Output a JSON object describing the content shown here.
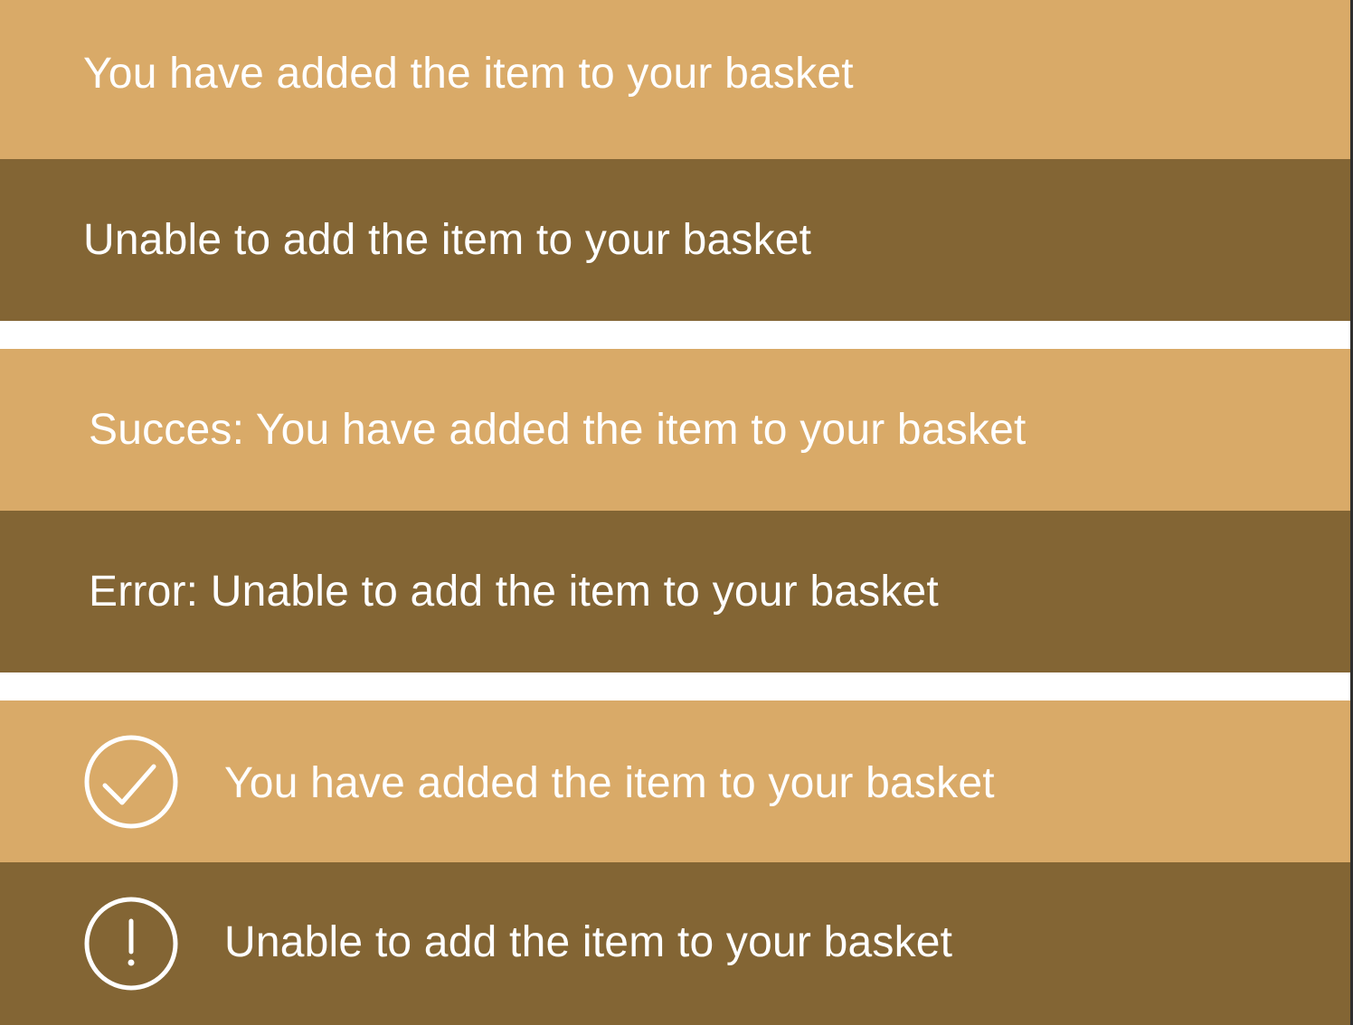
{
  "colors": {
    "success_background": "#d9aa68",
    "error_background": "#836534",
    "text": "#ffffff",
    "separator": "#ffffff"
  },
  "notifications": [
    {
      "variant": "success",
      "message": "You have added the item to your basket",
      "icon": null
    },
    {
      "variant": "error",
      "message": "Unable to add the item to your basket",
      "icon": null
    },
    {
      "variant": "success",
      "message": "Succes: You have added the item to your basket",
      "icon": null
    },
    {
      "variant": "error",
      "message": "Error: Unable to add the item to your basket",
      "icon": null
    },
    {
      "variant": "success",
      "message": "You have added the item to your basket",
      "icon": "check-circle-icon"
    },
    {
      "variant": "error",
      "message": "Unable to add the item to your basket",
      "icon": "exclamation-circle-icon"
    }
  ]
}
